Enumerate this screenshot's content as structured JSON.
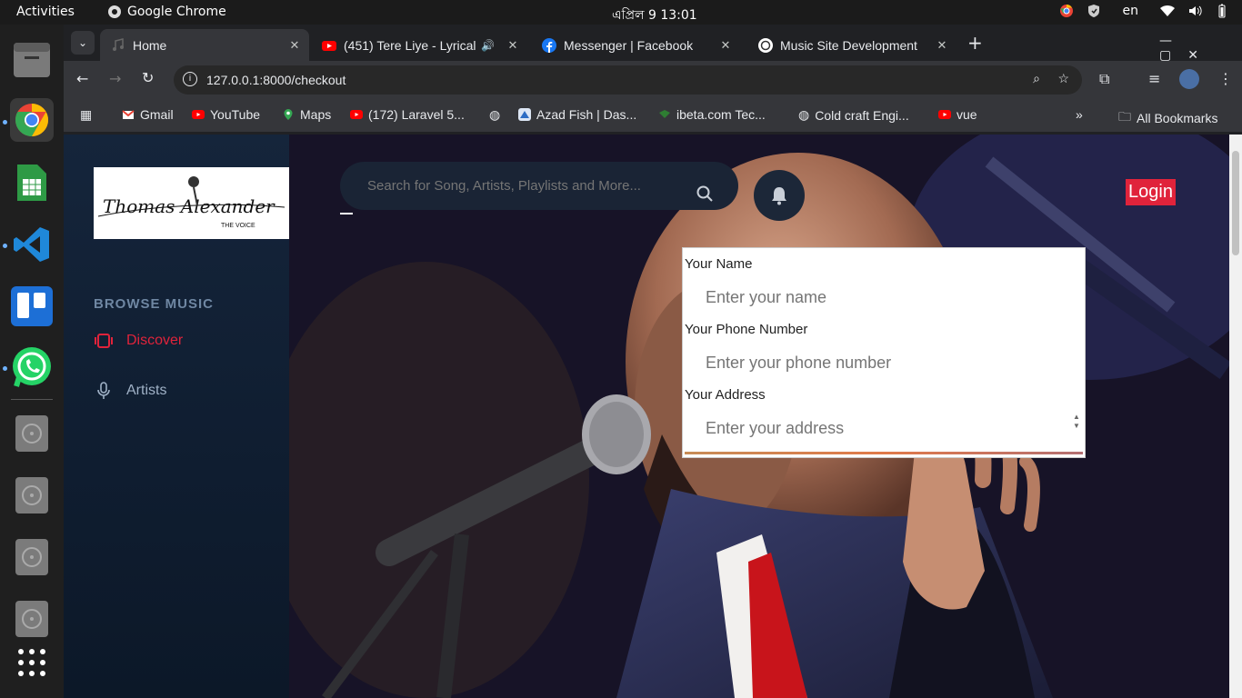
{
  "topbar": {
    "activities": "Activities",
    "app_name": "Google Chrome",
    "clock": "এপ্রিল 9  13:01",
    "lang": "en"
  },
  "tabs": [
    {
      "title": "Home",
      "active": true
    },
    {
      "title": "(451) Tere Liye - Lyrical",
      "active": false
    },
    {
      "title": "Messenger | Facebook",
      "active": false
    },
    {
      "title": "Music Site Development",
      "active": false
    }
  ],
  "toolbar": {
    "url": "127.0.0.1:8000/checkout"
  },
  "bookmarks": [
    "Gmail",
    "YouTube",
    "Maps",
    "(172) Laravel 5...",
    "Azad Fish | Das...",
    "ibeta.com Tec...",
    "Cold craft Engi...",
    "vue",
    "All Bookmarks"
  ],
  "site": {
    "logo_line1": "Thomas Alexander",
    "logo_line2": "THE VOICE",
    "section": "BROWSE MUSIC",
    "nav": [
      {
        "label": "Discover",
        "active": true
      },
      {
        "label": "Artists",
        "active": false
      }
    ],
    "search_placeholder": "Search for Song, Artists, Playlists and More...",
    "login": "Login",
    "form": {
      "name_label": "Your Name",
      "name_placeholder": "Enter your name",
      "phone_label": "Your Phone Number",
      "phone_placeholder": "Enter your phone number",
      "address_label": "Your Address",
      "address_placeholder": "Enter your address"
    }
  },
  "colors": {
    "accent": "#e0233b",
    "sidebar": "#13233a",
    "chrome_bg": "#202124",
    "toolbar": "#35363a"
  }
}
